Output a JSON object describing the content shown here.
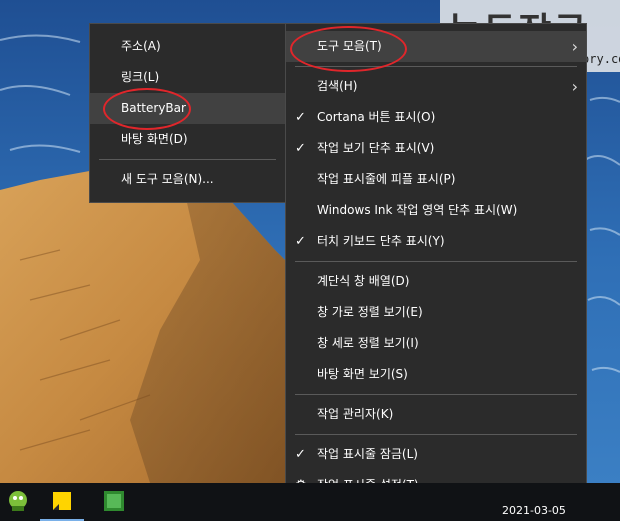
{
  "watermark": {
    "title": "녹두장군",
    "url": "http://mainia.tistory.com"
  },
  "toolbar_submenu": {
    "items": [
      {
        "label": "주소(A)"
      },
      {
        "label": "링크(L)"
      },
      {
        "label": "BatteryBar"
      },
      {
        "label": "바탕 화면(D)"
      },
      {
        "label": "새 도구 모음(N)..."
      }
    ]
  },
  "context_menu": {
    "items": [
      {
        "label": "도구 모음(T)"
      },
      {
        "label": "검색(H)"
      },
      {
        "label": "Cortana 버튼 표시(O)"
      },
      {
        "label": "작업 보기 단추 표시(V)"
      },
      {
        "label": "작업 표시줄에 피플 표시(P)"
      },
      {
        "label": "Windows Ink 작업 영역 단추 표시(W)"
      },
      {
        "label": "터치 키보드 단추 표시(Y)"
      },
      {
        "label": "계단식 창 배열(D)"
      },
      {
        "label": "창 가로 정렬 보기(E)"
      },
      {
        "label": "창 세로 정렬 보기(I)"
      },
      {
        "label": "바탕 화면 보기(S)"
      },
      {
        "label": "작업 관리자(K)"
      },
      {
        "label": "작업 표시줄 잠금(L)"
      },
      {
        "label": "작업 표시줄 설정(T)"
      }
    ]
  },
  "taskbar": {
    "date": "2021-03-05"
  },
  "colors": {
    "menu_bg": "#2b2b2b",
    "highlight": "#414141",
    "annotation": "#e0262b"
  }
}
